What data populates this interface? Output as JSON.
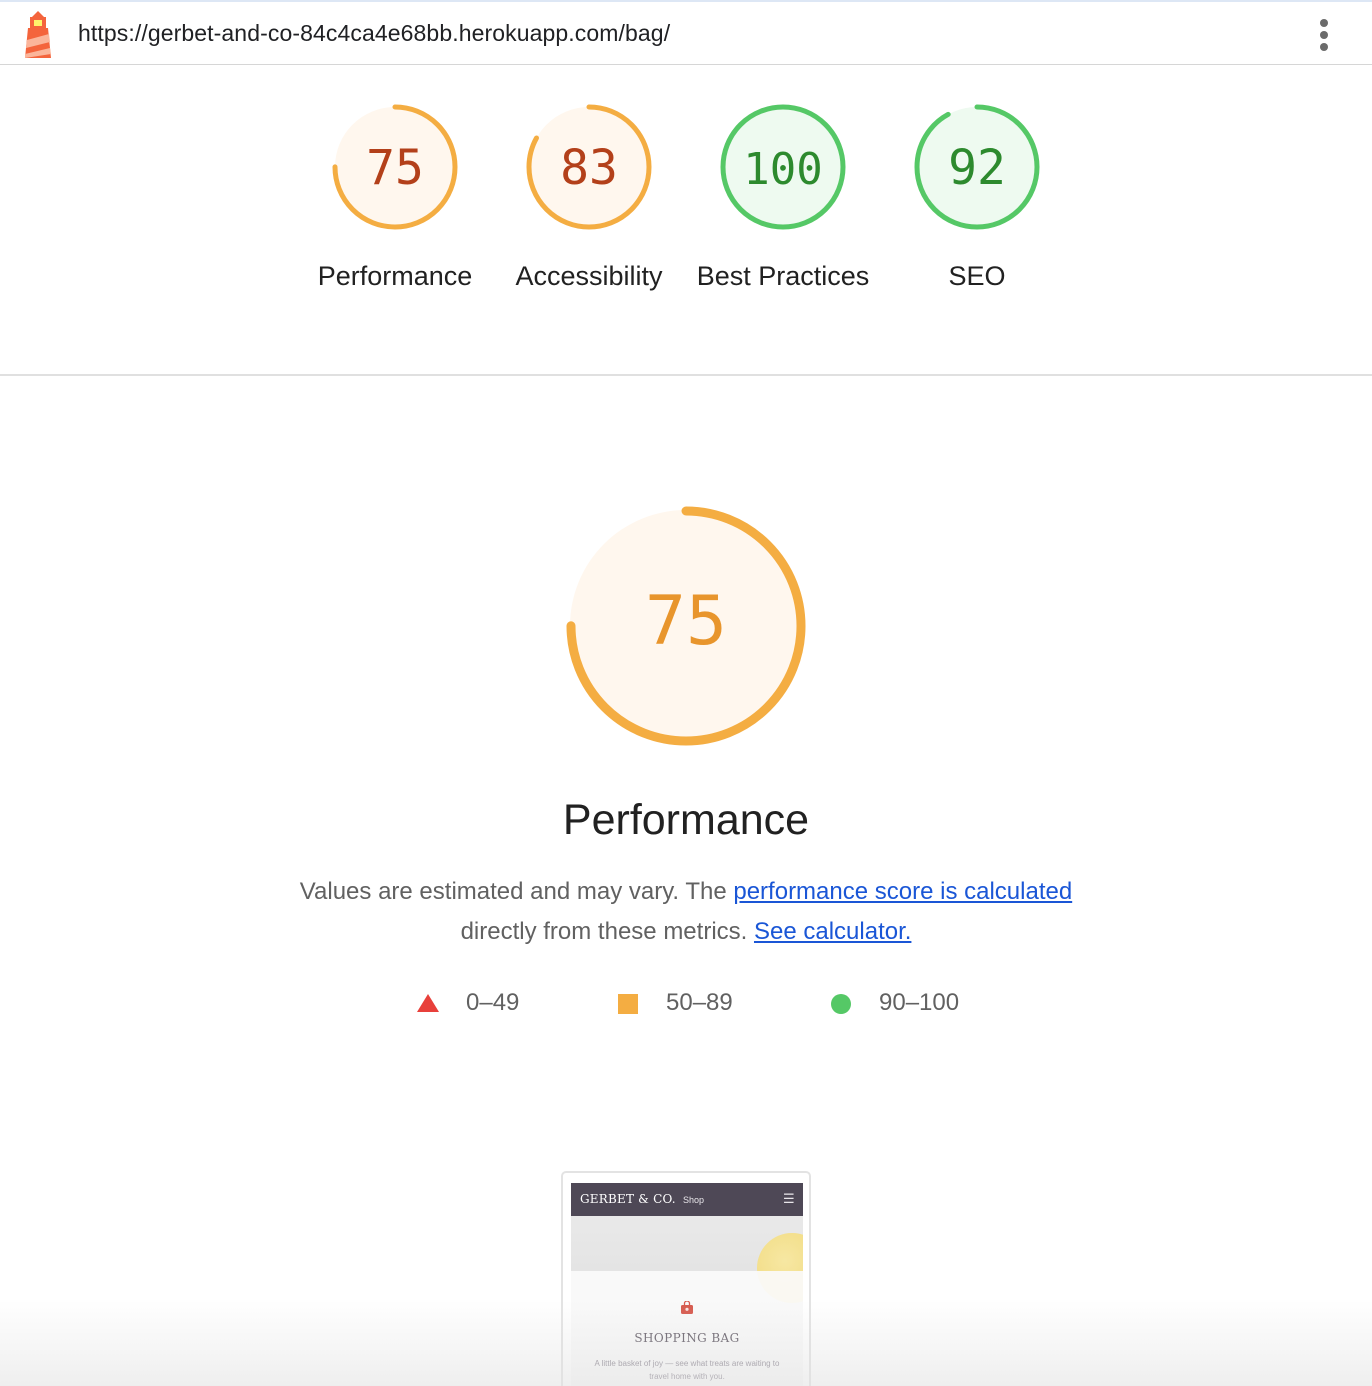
{
  "topbar": {
    "url": "https://gerbet-and-co-84c4ca4e68bb.herokuapp.com/bag/",
    "logo_icon": "lighthouse-icon",
    "menu_icon": "kebab-menu-icon"
  },
  "categories": [
    {
      "id": "performance",
      "score": "75",
      "score_value": 75,
      "label": "Performance",
      "rating": "average"
    },
    {
      "id": "accessibility",
      "score": "83",
      "score_value": 83,
      "label": "Accessibility",
      "rating": "average"
    },
    {
      "id": "best-practices",
      "score": "100",
      "score_value": 100,
      "label": "Best Practices",
      "rating": "pass"
    },
    {
      "id": "seo",
      "score": "92",
      "score_value": 92,
      "label": "SEO",
      "rating": "pass"
    }
  ],
  "colors": {
    "average": "#f4ad42",
    "average_fill": "#fff7ee",
    "average_text": "#b3401a",
    "pass": "#55c866",
    "pass_fill": "#eefaf0",
    "pass_text": "#2d8a2e",
    "fail": "#e8403b",
    "link": "#1a56d6"
  },
  "performance_section": {
    "score": "75",
    "score_value": 75,
    "title": "Performance",
    "desc_prefix": "Values are estimated and may vary. The",
    "desc_link_1": "performance score is calculated",
    "desc_middle": "directly from these metrics.",
    "desc_link_2": "See calculator."
  },
  "legend": [
    {
      "shape": "triangle",
      "range": "0–49"
    },
    {
      "shape": "square",
      "range": "50–89"
    },
    {
      "shape": "circle",
      "range": "90–100"
    }
  ],
  "thumbnail": {
    "brand": "GERBET & CO.",
    "nav_link": "Shop",
    "menu_icon": "hamburger-icon",
    "bag_icon": "shopping-bag-icon",
    "title": "SHOPPING BAG",
    "subtitle": "A little basket of joy — see what treats are waiting to travel home with you."
  }
}
